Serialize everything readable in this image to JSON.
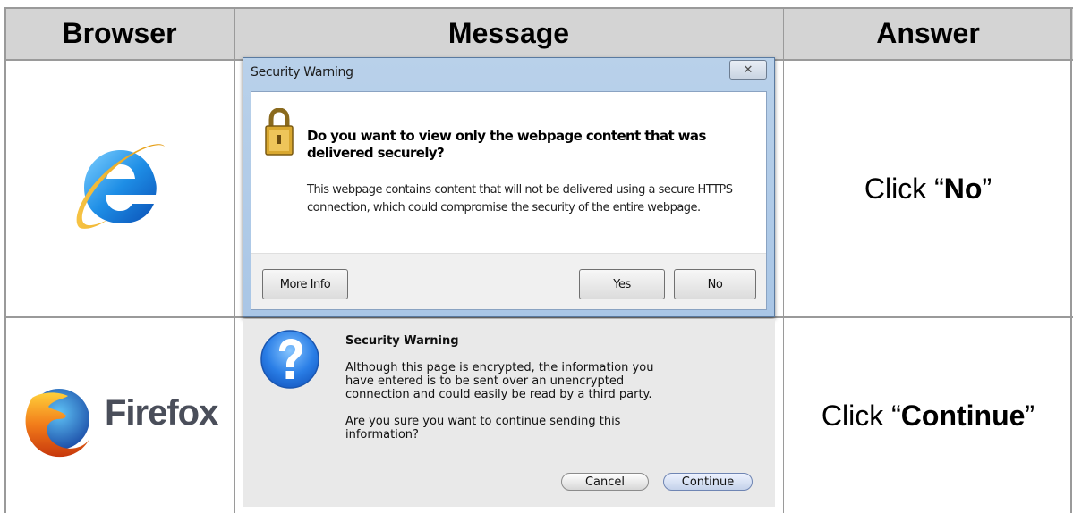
{
  "headers": {
    "browser": "Browser",
    "message": "Message",
    "answer": "Answer"
  },
  "rows": [
    {
      "browser_icon": "internet-explorer-logo",
      "dialog": {
        "title": "Security Warning",
        "close_glyph": "✕",
        "question": "Do you want to view only the webpage content that was delivered securely?",
        "description": "This webpage contains content that will not be delivered using a secure HTTPS connection, which could compromise the security of the entire webpage.",
        "buttons": {
          "more_info": "More Info",
          "yes": "Yes",
          "no": "No"
        }
      },
      "answer": {
        "prefix": "Click “",
        "bold": "No",
        "suffix": "”"
      }
    },
    {
      "browser_icon": "firefox-logo",
      "browser_name": "Firefox",
      "dialog": {
        "title": "Security Warning",
        "paragraph1_line1": "Although this page is encrypted, the information you",
        "paragraph1_line2": "have entered is to be sent over an unencrypted",
        "paragraph1_line3": "connection and could easily be read by a third party.",
        "paragraph2_line1": "Are you sure you want to continue sending this",
        "paragraph2_line2": "information?",
        "buttons": {
          "cancel": "Cancel",
          "continue": "Continue"
        }
      },
      "answer": {
        "prefix": "Click “",
        "bold": "Continue",
        "suffix": "”"
      }
    }
  ],
  "colors": {
    "header_bg": "#d4d4d4",
    "grid": "#9a9a9a",
    "ie_frame": "#b9d1ea"
  }
}
